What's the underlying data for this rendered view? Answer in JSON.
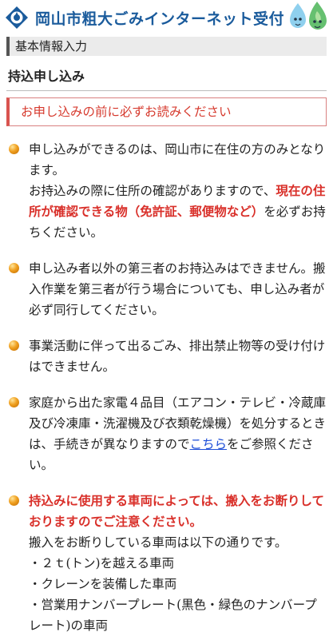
{
  "header": {
    "title": "岡山市粗大ごみインターネット受付",
    "logo": "okayama-city-emblem",
    "mascot": "mascot-characters"
  },
  "section": {
    "title": "基本情報入力"
  },
  "subsection": {
    "title": "持込申し込み"
  },
  "notice": {
    "text": "お申し込みの前に必ずお読みください"
  },
  "bullets": {
    "b1": {
      "text1": "申し込みができるのは、岡山市に在住の方のみとなります。",
      "text2": "お持込みの際に住所の確認がありますので、",
      "red": "現在の住所が確認できる物（免許証、郵便物など）",
      "text3": "を必ずお持ちください。"
    },
    "b2": {
      "text": "申し込み者以外の第三者のお持込みはできません。搬入作業を第三者が行う場合についても、申し込み者が必ず同行してください。"
    },
    "b3": {
      "text": "事業活動に伴って出るごみ、排出禁止物等の受け付けはできません。"
    },
    "b4": {
      "text1": "家庭から出た家電４品目（エアコン・テレビ・冷蔵庫及び冷凍庫・洗濯機及び衣類乾燥機）を処分するときは、手続きが異なりますので",
      "link": "こちら",
      "text2": "をご参照ください。"
    },
    "b5": {
      "red": "持込みに使用する車両によっては、搬入をお断りしておりますのでご注意ください。",
      "text": "搬入をお断りしている車両は以下の通りです。",
      "line1": "・２ｔ(トン)を越える車両",
      "line2": "・クレーンを装備した車両",
      "line3": "・営業用ナンバープレート(黒色・緑色のナンバープレート)の車両"
    }
  }
}
